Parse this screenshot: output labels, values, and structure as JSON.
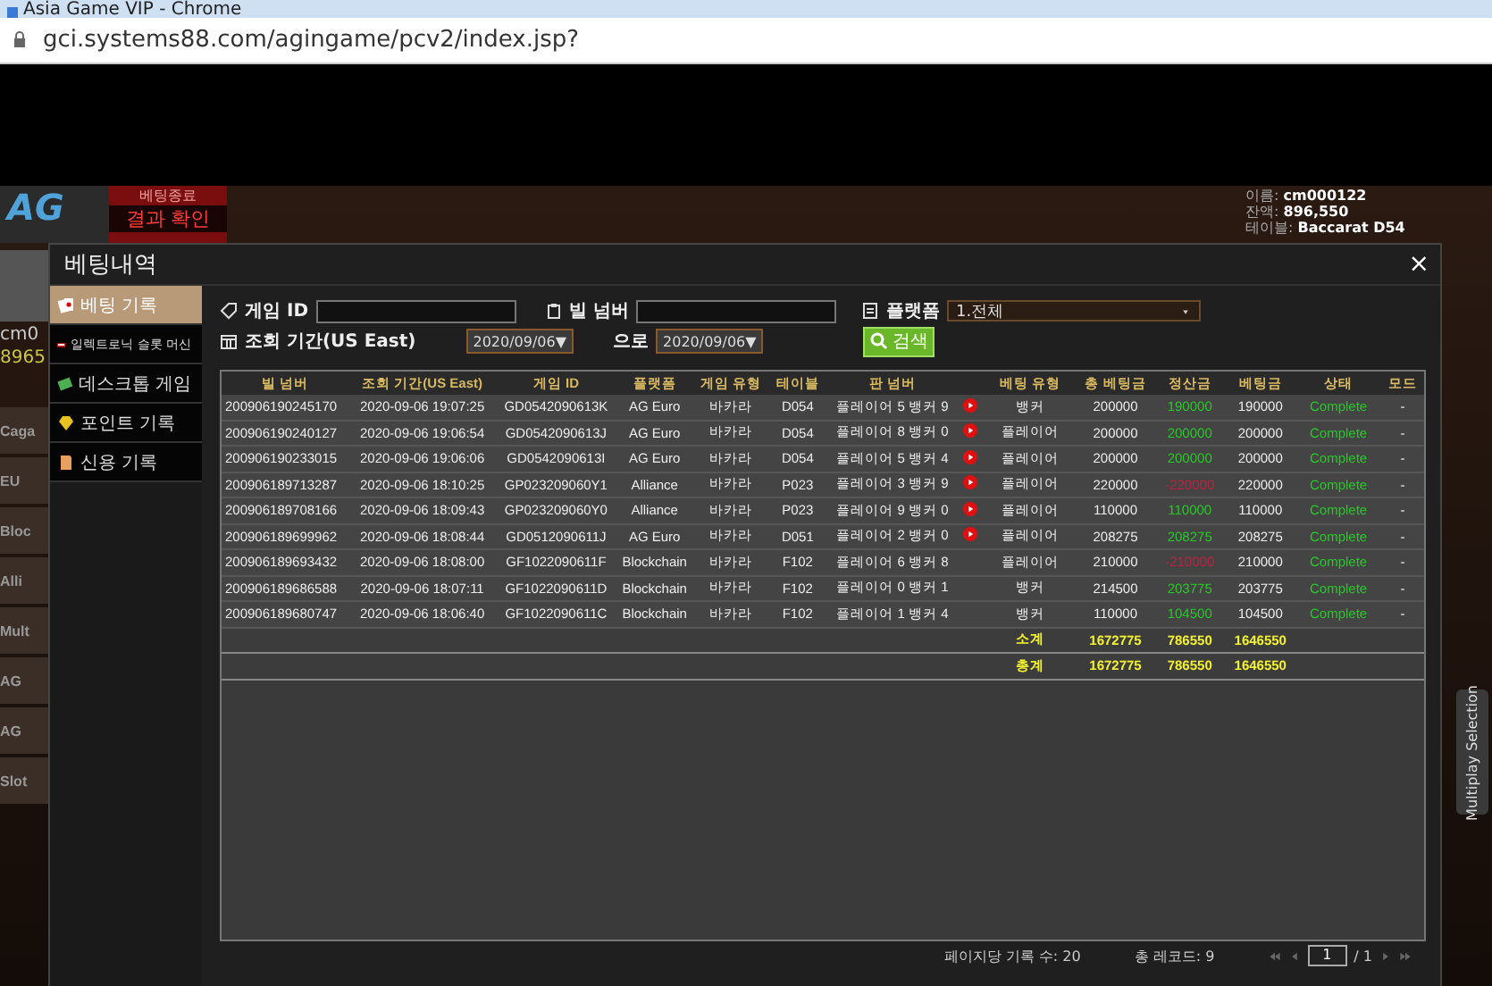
{
  "browser": {
    "title": "Asia Game VIP - Chrome",
    "url": "gci.systems88.com/agingame/pcv2/index.jsp?"
  },
  "game": {
    "logo": "AG",
    "notice_title": "베팅종료",
    "notice_button": "결과 확인",
    "player_name": "cm0",
    "player_balance": "8965",
    "side_items": [
      "Caga",
      "EU",
      "Bloc",
      "Alli",
      "Mult",
      "AG",
      "AG",
      "Slot"
    ],
    "info": [
      {
        "label": "이름:",
        "value": "cm000122"
      },
      {
        "label": "잔액:",
        "value": "896,550"
      },
      {
        "label": "테이블:",
        "value": "Baccarat D54"
      }
    ],
    "multiplay": "Multiplay Selection"
  },
  "modal": {
    "title": "베팅내역",
    "close": "×",
    "tabs": [
      {
        "label": "베팅 기록",
        "selected": true
      },
      {
        "label": "일렉트로닉 슬롯 머신",
        "selected": false
      },
      {
        "label": "데스크톱 게임",
        "selected": false
      },
      {
        "label": "포인트 기록",
        "selected": false
      },
      {
        "label": "신용 기록",
        "selected": false
      }
    ],
    "filters": {
      "game_id_label": "게임 ID",
      "bill_label": "빌 넘버",
      "platform_label": "플랫폼",
      "platform_value": "1.전체",
      "period_label": "조회 기간(US East)",
      "date_from": "2020/09/06▼",
      "to_label": "으로",
      "date_to": "2020/09/06▼",
      "search": "검색"
    },
    "table": {
      "columns": [
        "빌 넘버",
        "조회 기간(US East)",
        "게임 ID",
        "플랫폼",
        "게임 유형",
        "테이블",
        "판 넘버",
        "",
        "베팅 유형",
        "총 베팅금",
        "정산금",
        "베팅금",
        "상태",
        "모드"
      ],
      "rows": [
        {
          "bill": "200906190245170",
          "time": "2020-09-06 19:07:25",
          "game_id": "GD0542090613K",
          "platform": "AG Euro",
          "type": "바카라",
          "table": "D054",
          "result": "플레이어 5 뱅커 9",
          "replay": true,
          "bet_type": "뱅커",
          "total": "200000",
          "settle": "190000",
          "settle_negative": false,
          "bet": "190000",
          "status": "Complete",
          "mode": "-"
        },
        {
          "bill": "200906190240127",
          "time": "2020-09-06 19:06:54",
          "game_id": "GD0542090613J",
          "platform": "AG Euro",
          "type": "바카라",
          "table": "D054",
          "result": "플레이어 8 뱅커 0",
          "replay": true,
          "bet_type": "플레이어",
          "total": "200000",
          "settle": "200000",
          "settle_negative": false,
          "bet": "200000",
          "status": "Complete",
          "mode": "-"
        },
        {
          "bill": "200906190233015",
          "time": "2020-09-06 19:06:06",
          "game_id": "GD0542090613I",
          "platform": "AG Euro",
          "type": "바카라",
          "table": "D054",
          "result": "플레이어 5 뱅커 4",
          "replay": true,
          "bet_type": "플레이어",
          "total": "200000",
          "settle": "200000",
          "settle_negative": false,
          "bet": "200000",
          "status": "Complete",
          "mode": "-"
        },
        {
          "bill": "200906189713287",
          "time": "2020-09-06 18:10:25",
          "game_id": "GP023209060Y1",
          "platform": "Alliance",
          "type": "바카라",
          "table": "P023",
          "result": "플레이어 3 뱅커 9",
          "replay": true,
          "bet_type": "플레이어",
          "total": "220000",
          "settle": "-220000",
          "settle_negative": true,
          "bet": "220000",
          "status": "Complete",
          "mode": "-"
        },
        {
          "bill": "200906189708166",
          "time": "2020-09-06 18:09:43",
          "game_id": "GP023209060Y0",
          "platform": "Alliance",
          "type": "바카라",
          "table": "P023",
          "result": "플레이어 9 뱅커 0",
          "replay": true,
          "bet_type": "플레이어",
          "total": "110000",
          "settle": "110000",
          "settle_negative": false,
          "bet": "110000",
          "status": "Complete",
          "mode": "-"
        },
        {
          "bill": "200906189699962",
          "time": "2020-09-06 18:08:44",
          "game_id": "GD0512090611J",
          "platform": "AG Euro",
          "type": "바카라",
          "table": "D051",
          "result": "플레이어 2 뱅커 0",
          "replay": true,
          "bet_type": "플레이어",
          "total": "208275",
          "settle": "208275",
          "settle_negative": false,
          "bet": "208275",
          "status": "Complete",
          "mode": "-"
        },
        {
          "bill": "200906189693432",
          "time": "2020-09-06 18:08:00",
          "game_id": "GF1022090611F",
          "platform": "Blockchain",
          "type": "바카라",
          "table": "F102",
          "result": "플레이어 6 뱅커 8",
          "replay": false,
          "bet_type": "플레이어",
          "total": "210000",
          "settle": "-210000",
          "settle_negative": true,
          "bet": "210000",
          "status": "Complete",
          "mode": "-"
        },
        {
          "bill": "200906189686588",
          "time": "2020-09-06 18:07:11",
          "game_id": "GF1022090611D",
          "platform": "Blockchain",
          "type": "바카라",
          "table": "F102",
          "result": "플레이어 0 뱅커 1",
          "replay": false,
          "bet_type": "뱅커",
          "total": "214500",
          "settle": "203775",
          "settle_negative": false,
          "bet": "203775",
          "status": "Complete",
          "mode": "-"
        },
        {
          "bill": "200906189680747",
          "time": "2020-09-06 18:06:40",
          "game_id": "GF1022090611C",
          "platform": "Blockchain",
          "type": "바카라",
          "table": "F102",
          "result": "플레이어 1 뱅커 4",
          "replay": false,
          "bet_type": "뱅커",
          "total": "110000",
          "settle": "104500",
          "settle_negative": false,
          "bet": "104500",
          "status": "Complete",
          "mode": "-"
        }
      ],
      "totals": [
        {
          "label": "소계",
          "total": "1672775",
          "settle": "786550",
          "bet": "1646550"
        },
        {
          "label": "총계",
          "total": "1672775",
          "settle": "786550",
          "bet": "1646550"
        }
      ]
    },
    "footer": {
      "per_page": "페이지당 기록 수: 20",
      "records": "총 레코드: 9",
      "page": "1",
      "pages": "/ 1"
    }
  }
}
